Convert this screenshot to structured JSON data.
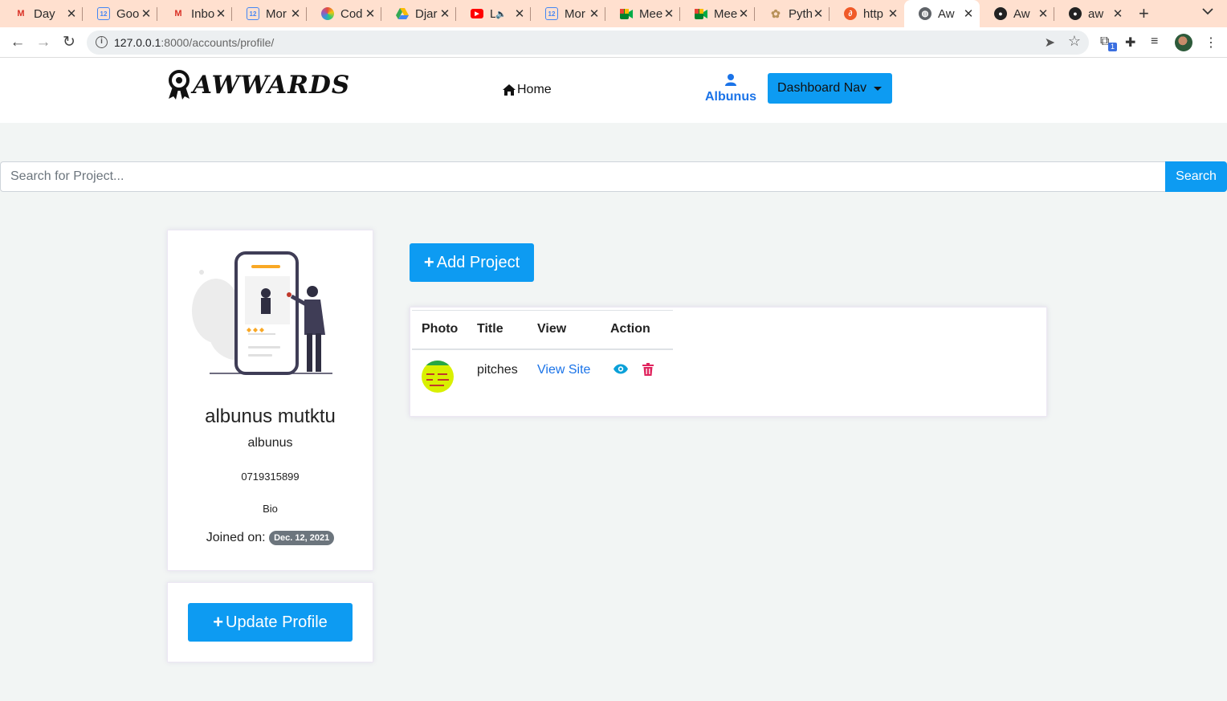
{
  "browser": {
    "tabs": [
      {
        "title": "Day",
        "icon": "gmail-icon",
        "active": false
      },
      {
        "title": "Goo",
        "icon": "calendar-icon",
        "active": false
      },
      {
        "title": "Inbo",
        "icon": "gmail-icon",
        "active": false
      },
      {
        "title": "Mor",
        "icon": "calendar-icon",
        "active": false
      },
      {
        "title": "Cod",
        "icon": "codewars-icon",
        "active": false
      },
      {
        "title": "Djar",
        "icon": "drive-icon",
        "active": false
      },
      {
        "title": "L",
        "icon": "youtube-icon",
        "active": false
      },
      {
        "title": "Mor",
        "icon": "calendar-icon",
        "active": false
      },
      {
        "title": "Mee",
        "icon": "meet-icon",
        "active": false
      },
      {
        "title": "Mee",
        "icon": "meet-icon",
        "active": false
      },
      {
        "title": "Pyth",
        "icon": "python-icon",
        "active": false
      },
      {
        "title": "http",
        "icon": "web-icon",
        "active": false
      },
      {
        "title": "Aw",
        "icon": "globe-icon",
        "active": true
      },
      {
        "title": "Aw",
        "icon": "github-icon",
        "active": false
      },
      {
        "title": "aw",
        "icon": "github-icon",
        "active": false
      }
    ],
    "url_host": "127.0.0.1",
    "url_rest": ":8000/accounts/profile/",
    "extension_badge": "1"
  },
  "nav": {
    "logo": "AWWARDS",
    "home_label": "Home",
    "user_label": "Albunus",
    "dashboard_label": "Dashboard Nav"
  },
  "search": {
    "placeholder": "Search for Project...",
    "button_label": "Search"
  },
  "profile": {
    "full_name": "albunus mutktu",
    "username": "albunus",
    "phone": "0719315899",
    "bio": "Bio",
    "joined_label": "Joined on:",
    "joined_date": "Dec. 12, 2021",
    "update_label": "Update Profile"
  },
  "projects": {
    "add_label": "Add Project",
    "headers": [
      "Photo",
      "Title",
      "View",
      "Action"
    ],
    "rows": [
      {
        "title": "pitches",
        "view_label": "View Site"
      }
    ]
  },
  "colors": {
    "accent": "#0d9bf2",
    "link": "#1a73e8",
    "danger": "#e0245e",
    "eye": "#0aa0d8",
    "tabbar": "#ffe0cf",
    "page_bg": "#f2f5f4"
  }
}
